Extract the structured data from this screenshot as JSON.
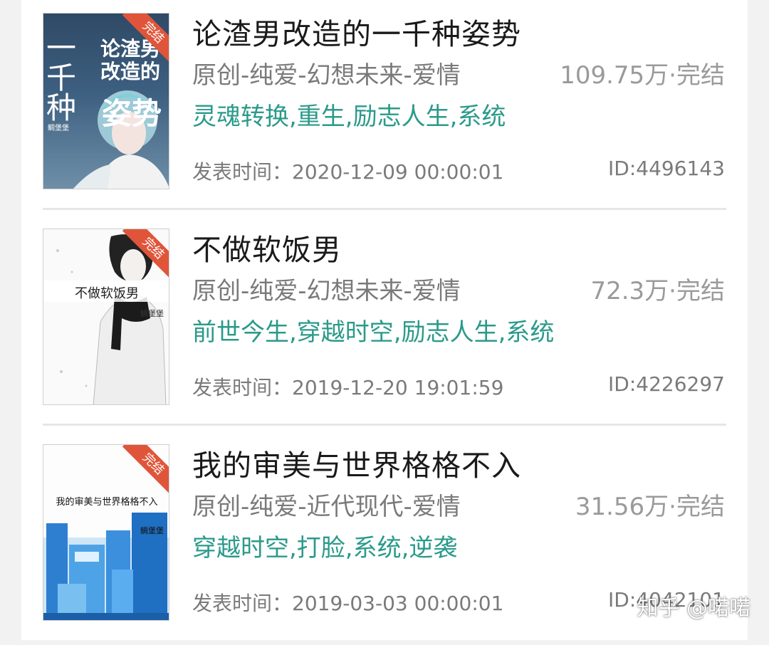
{
  "books": [
    {
      "title": "论渣男改造的一千种姿势",
      "category": "原创-纯爱-幻想未来-爱情",
      "count": "109.75万·完结",
      "tags": "灵魂转换,重生,励志人生,系统",
      "date": "发表时间：2020-12-09 00:00:01",
      "id": "ID:4496143",
      "cover": {
        "ribbon": "完结",
        "title_lines": [
          "一",
          "千",
          "种",
          "姿势"
        ],
        "subtitle_lines": [
          "论渣男",
          "改造的"
        ],
        "author": "鲷堡堡"
      }
    },
    {
      "title": "不做软饭男",
      "category": "原创-纯爱-幻想未来-爱情",
      "count": "72.3万·完结",
      "tags": "前世今生,穿越时空,励志人生,系统",
      "date": "发表时间：2019-12-20 19:01:59",
      "id": "ID:4226297",
      "cover": {
        "ribbon": "完结",
        "title": "不做软饭男",
        "author": "鲷堡堡"
      }
    },
    {
      "title": "我的审美与世界格格不入",
      "category": "原创-纯爱-近代现代-爱情",
      "count": "31.56万·完结",
      "tags": "穿越时空,打脸,系统,逆袭",
      "date": "发表时间：2019-03-03 00:00:01",
      "id": "ID:4042101",
      "cover": {
        "ribbon": "完结",
        "title": "我的审美与世界格格不入",
        "author": "鲷堡堡"
      }
    }
  ],
  "watermark": "知乎 @喏喏",
  "colors": {
    "tag_text": "#2b9a8a",
    "meta_text": "#7a7a7a",
    "ribbon": "#e0553a"
  }
}
